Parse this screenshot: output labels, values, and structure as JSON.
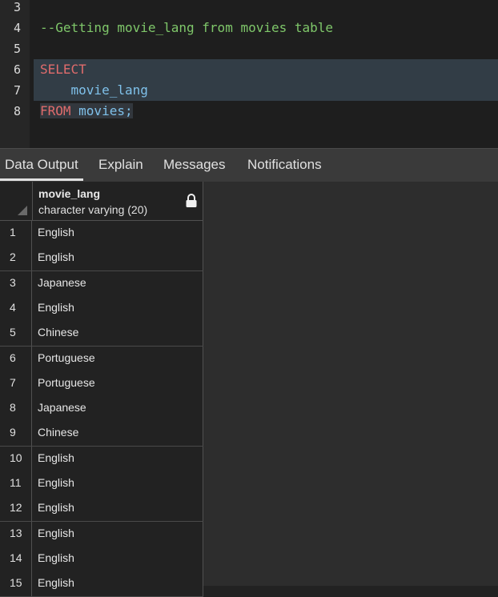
{
  "editor": {
    "lines": [
      {
        "num": "3",
        "text": ""
      },
      {
        "num": "4",
        "text": "--Getting movie_lang from movies table"
      },
      {
        "num": "5",
        "text": ""
      },
      {
        "num": "6",
        "keyword": "SELECT"
      },
      {
        "num": "7",
        "identifier": "    movie_lang"
      },
      {
        "num": "8",
        "keyword": "FROM",
        "identifier": " movies;"
      }
    ]
  },
  "tabs": [
    {
      "label": "Data Output",
      "active": true
    },
    {
      "label": "Explain"
    },
    {
      "label": "Messages"
    },
    {
      "label": "Notifications"
    }
  ],
  "grid": {
    "column": {
      "name": "movie_lang",
      "type": "character varying (20)",
      "icon": "lock-icon"
    },
    "rows": [
      {
        "n": "1",
        "value": "English"
      },
      {
        "n": "2",
        "value": "English"
      },
      {
        "n": "3",
        "value": "Japanese"
      },
      {
        "n": "4",
        "value": "English"
      },
      {
        "n": "5",
        "value": "Chinese"
      },
      {
        "n": "6",
        "value": "Portuguese"
      },
      {
        "n": "7",
        "value": "Portuguese"
      },
      {
        "n": "8",
        "value": "Japanese"
      },
      {
        "n": "9",
        "value": "Chinese"
      },
      {
        "n": "10",
        "value": "English"
      },
      {
        "n": "11",
        "value": "English"
      },
      {
        "n": "12",
        "value": "English"
      },
      {
        "n": "13",
        "value": "English"
      },
      {
        "n": "14",
        "value": "English"
      },
      {
        "n": "15",
        "value": "English"
      }
    ]
  }
}
